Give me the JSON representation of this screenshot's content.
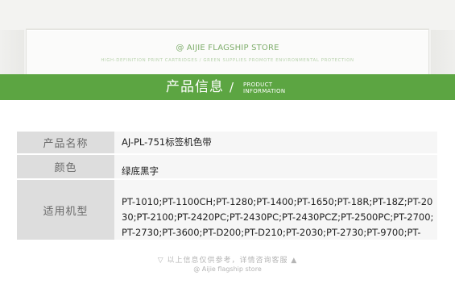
{
  "banner": {
    "store_name": "@ AIJIE FLAGSHIP STORE",
    "tagline": "HIGH-DEFINITION PRINT CARTRIDGES / GREEN SUPPLIES PROMOTE ENVIRONMENTAL PROTECTION"
  },
  "section_bar": {
    "title": "产品信息",
    "slash": "/",
    "en_line1": "PRODUCT",
    "en_line2": "INFORMATION"
  },
  "spec_table": {
    "rows": [
      {
        "label": "产品名称",
        "value": "AJ-PL-751标签机色带"
      },
      {
        "label": "颜色",
        "value": "绿底黑字"
      },
      {
        "label": "适用机型",
        "value": "PT-1010;PT-1100CH;PT-1280;PT-1400;PT-1650;PT-18R;PT-18Z;PT-2030;PT-2100;PT-2420PC;PT-2430PC;PT-2430PCZ;PT-2500PC;PT-2700;PT-2730;PT-3600;PT-D200;PT-D210;PT-2030;PT-2730;PT-9700;PT-"
      }
    ]
  },
  "footer": {
    "note": "▽ 以上信息仅供参考，详情咨询客服 ▲",
    "store": "@ Aijie flagship store"
  },
  "colors": {
    "accent_green": "#5ca542",
    "label_bg": "#dddddd",
    "value_bg": "#f6f6f6"
  }
}
